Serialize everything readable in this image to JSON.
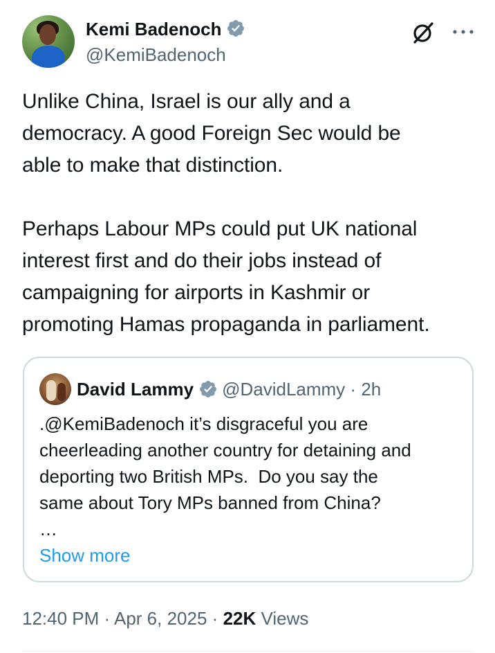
{
  "tweet": {
    "author_name": "Kemi Badenoch",
    "author_handle": "@KemiBadenoch",
    "text": "Unlike China, Israel is our ally and a\ndemocracy. A good Foreign Sec would be\nable to make that distinction.\n\nPerhaps Labour MPs could put UK national\ninterest first and do their jobs instead of\ncampaigning for airports in Kashmir or\npromoting Hamas propaganda in parliament.",
    "time": "12:40 PM",
    "date": "Apr 6, 2025",
    "views_count": "22K",
    "views_label": "Views"
  },
  "quote": {
    "author_name": "David Lammy",
    "author_handle": "@DavidLammy",
    "separator": "·",
    "age": "2h",
    "text": ".@KemiBadenoch it’s disgraceful you are\ncheerleading another country for detaining and\ndeporting two British MPs.  Do you say the\nsame about Tory MPs banned from China?\n…",
    "show_more": "Show more"
  },
  "meta_separator": "·",
  "icons": {
    "verified": "verified-badge-icon",
    "grok": "grok-icon",
    "more": "more-options-icon"
  },
  "colors": {
    "text": "#0f1419",
    "secondary": "#536471",
    "link": "#1d9bf0",
    "border": "#cfd9de",
    "verified": "#829aab"
  }
}
